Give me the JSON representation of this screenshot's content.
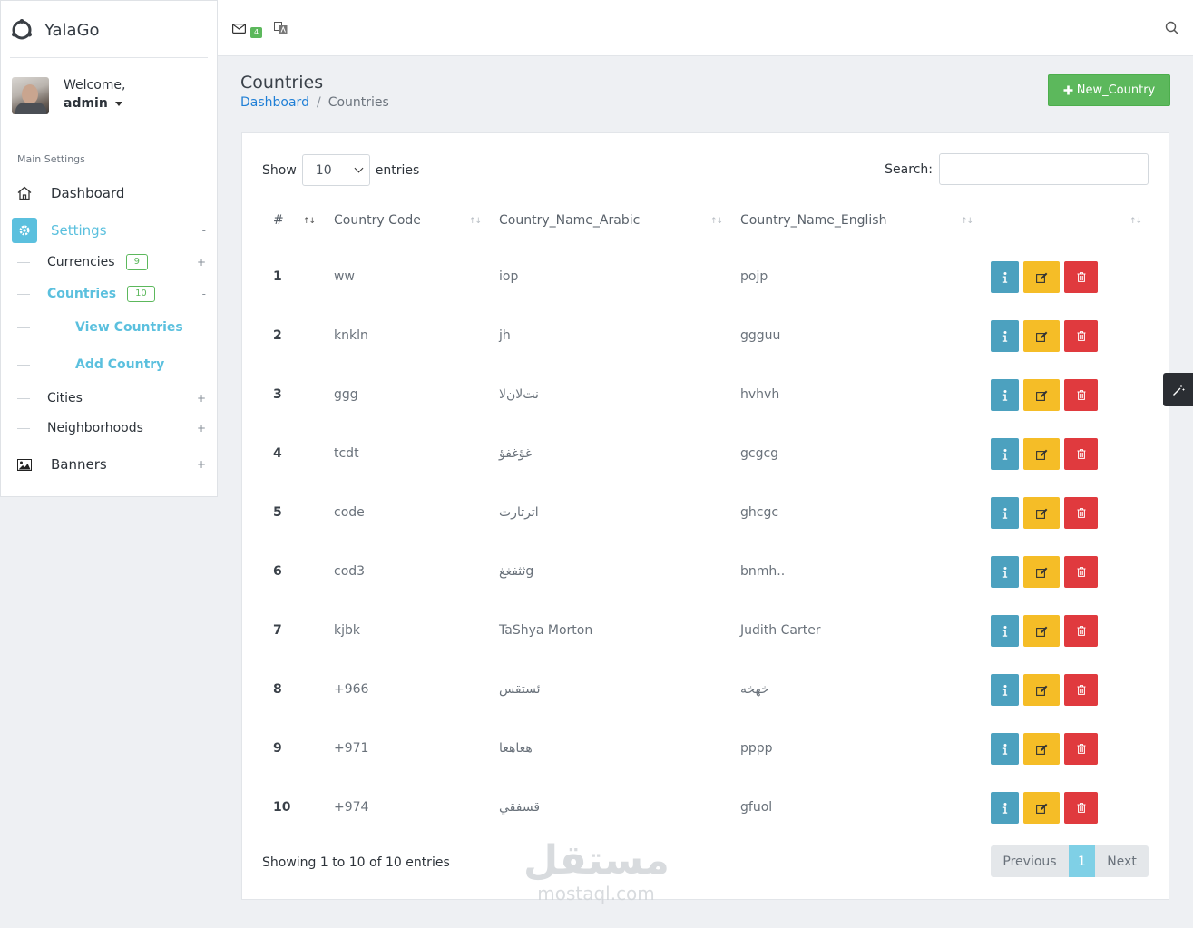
{
  "brand": {
    "name": "YalaGo"
  },
  "user": {
    "welcome": "Welcome,",
    "name": "admin"
  },
  "sidebar": {
    "section_title": "Main Settings",
    "dashboard": "Dashboard",
    "settings": {
      "label": "Settings",
      "toggle": "-"
    },
    "currencies": {
      "label": "Currencies",
      "count": "9",
      "toggle": "+"
    },
    "countries": {
      "label": "Countries",
      "count": "10",
      "toggle": "-"
    },
    "view_countries": "View Countries",
    "add_country": "Add Country",
    "cities": {
      "label": "Cities",
      "toggle": "+"
    },
    "neighborhoods": {
      "label": "Neighborhoods",
      "toggle": "+"
    },
    "banners": {
      "label": "Banners",
      "toggle": "+"
    }
  },
  "topbar": {
    "mail_count": "4"
  },
  "page": {
    "title": "Countries",
    "breadcrumb": {
      "home": "Dashboard",
      "sep": "/",
      "current": "Countries"
    },
    "new_button": "New_Country"
  },
  "table_controls": {
    "show": "Show",
    "entries_value": "10",
    "entries": "entries",
    "search_label": "Search:"
  },
  "table": {
    "columns": [
      "#",
      "Country Code",
      "Country_Name_Arabic",
      "Country_Name_English"
    ],
    "rows": [
      {
        "id": "1",
        "code": "ww",
        "arabic": "iop",
        "english": "pojp"
      },
      {
        "id": "2",
        "code": "knkln",
        "arabic": "jh",
        "english": "ggguu"
      },
      {
        "id": "3",
        "code": "ggg",
        "arabic": "نت‌لان‌لا",
        "english": "hvhvh"
      },
      {
        "id": "4",
        "code": "tcdt",
        "arabic": "غؤغفؤ",
        "english": "gcgcg"
      },
      {
        "id": "5",
        "code": "code",
        "arabic": "اترتارت",
        "english": "ghcgc"
      },
      {
        "id": "6",
        "code": "cod3",
        "arabic": "ثثفغغg",
        "english": "bnmh.."
      },
      {
        "id": "7",
        "code": "kjbk",
        "arabic": "TaShya Morton",
        "english": "Judith Carter"
      },
      {
        "id": "8",
        "code": "+966",
        "arabic": "ئستقس",
        "english": "خهخه"
      },
      {
        "id": "9",
        "code": "+971",
        "arabic": "هعاهعا",
        "english": "pppp"
      },
      {
        "id": "10",
        "code": "+974",
        "arabic": "قسفقي",
        "english": "gfuol"
      }
    ]
  },
  "footer": {
    "showing": "Showing 1 to 10 of 10 entries",
    "prev": "Previous",
    "page": "1",
    "next": "Next"
  },
  "watermark": {
    "arabic": "مستقل",
    "latin": "mostaql.com"
  },
  "colors": {
    "accent": "#5bc0de",
    "success": "#5cb85c",
    "info_btn": "#4ca1bf",
    "edit_btn": "#f5bd27",
    "delete_btn": "#e03a3e"
  }
}
